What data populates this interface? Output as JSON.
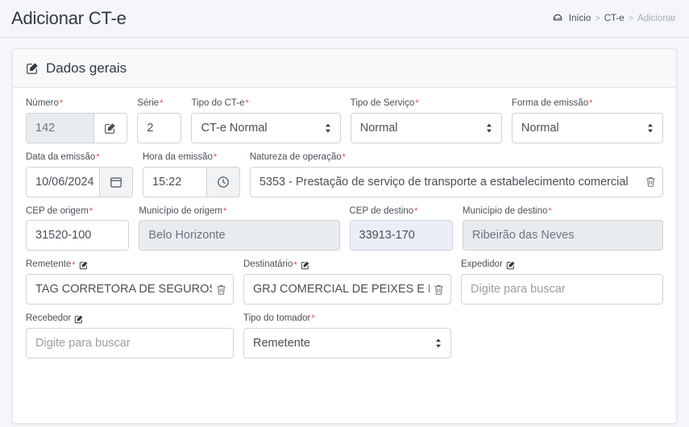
{
  "header": {
    "title": "Adicionar CT-e",
    "breadcrumb": {
      "home_icon": "dashboard-icon",
      "home": "Início",
      "sep1": ">",
      "section": "CT-e",
      "sep2": ">",
      "current": "Adicionar"
    }
  },
  "card": {
    "icon": "edit-square-icon",
    "title": "Dados gerais"
  },
  "form": {
    "numero": {
      "label": "Número",
      "required": true,
      "value": "142",
      "disabled": true,
      "append_icon": "edit-square-icon"
    },
    "serie": {
      "label": "Série",
      "required": true,
      "value": "2"
    },
    "tipo_cte": {
      "label": "Tipo do CT-e",
      "required": true,
      "value": "CT-e Normal",
      "caret_icon": "chevron-updown-icon"
    },
    "tipo_servico": {
      "label": "Tipo de Serviço",
      "required": true,
      "value": "Normal",
      "caret_icon": "chevron-updown-icon"
    },
    "forma_emissao": {
      "label": "Forma de emissão",
      "required": true,
      "value": "Normal",
      "caret_icon": "chevron-updown-icon"
    },
    "data_emissao": {
      "label": "Data da emissão",
      "required": true,
      "value": "10/06/2024",
      "append_icon": "calendar-icon"
    },
    "hora_emissao": {
      "label": "Hora da emissão",
      "required": true,
      "value": "15:22",
      "append_icon": "clock-icon"
    },
    "natureza_operacao": {
      "label": "Natureza de operação",
      "required": true,
      "value": "5353 - Prestação de serviço de transporte a estabelecimento comercial",
      "clear_icon": "trash-icon"
    },
    "cep_origem": {
      "label": "CEP de origem",
      "required": true,
      "value": "31520-100"
    },
    "municipio_origem": {
      "label": "Município de origem",
      "required": true,
      "value": "Belo Horizonte",
      "disabled": true
    },
    "cep_destino": {
      "label": "CEP de destino",
      "required": true,
      "value": "33913-170",
      "highlight": true
    },
    "municipio_destino": {
      "label": "Município de destino",
      "required": true,
      "value": "Ribeirão das Neves",
      "disabled": true
    },
    "remetente": {
      "label": "Remetente",
      "required": true,
      "label_icon": "edit-square-icon",
      "value": "TAG CORRETORA DE SEGUROS DE VIDA LTDA",
      "clear_icon": "trash-icon"
    },
    "destinatario": {
      "label": "Destinatário",
      "required": true,
      "label_icon": "edit-square-icon",
      "value": "GRJ COMERCIAL DE PEIXES E LEGUMES LTDA",
      "clear_icon": "trash-icon"
    },
    "expedidor": {
      "label": "Expedidor",
      "required": false,
      "label_icon": "edit-square-icon",
      "placeholder": "Digite para buscar",
      "value": ""
    },
    "recebedor": {
      "label": "Recebedor",
      "required": false,
      "label_icon": "edit-square-icon",
      "placeholder": "Digite para buscar",
      "value": ""
    },
    "tipo_tomador": {
      "label": "Tipo do tomador",
      "required": true,
      "value": "Remetente",
      "caret_icon": "chevron-updown-icon"
    }
  },
  "colors": {
    "page_bg": "#f4f6f9",
    "card_bg": "#ffffff",
    "border": "#ced4da",
    "text": "#495057",
    "required": "#e74c3c",
    "disabled_bg": "#e9ecef",
    "highlight_bg": "#eaeef8"
  }
}
